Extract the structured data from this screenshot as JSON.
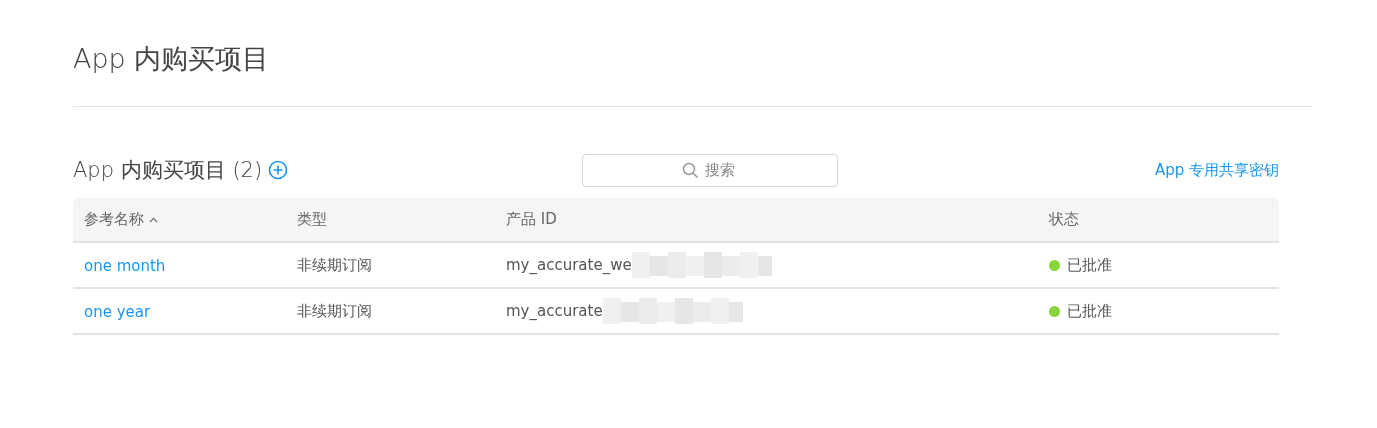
{
  "page_title": "App 内购买项目",
  "section": {
    "title": "App 内购买项目 (2)",
    "search": {
      "placeholder": "搜索"
    },
    "link": "App 专用共享密钥"
  },
  "table": {
    "columns": [
      {
        "label": "参考名称",
        "sorted": true
      },
      {
        "label": "类型",
        "sorted": false
      },
      {
        "label": "产品 ID",
        "sorted": false
      },
      {
        "label": "状态",
        "sorted": false
      }
    ],
    "rows": [
      {
        "name": "one month",
        "type": "非续期订阅",
        "product_id": "my_accurate_we",
        "status": "已批准",
        "color": "#8ad33a"
      },
      {
        "name": "one year",
        "type": "非续期订阅",
        "product_id": "my_accurate",
        "status": "已批准",
        "color": "#8ad33a"
      }
    ]
  }
}
